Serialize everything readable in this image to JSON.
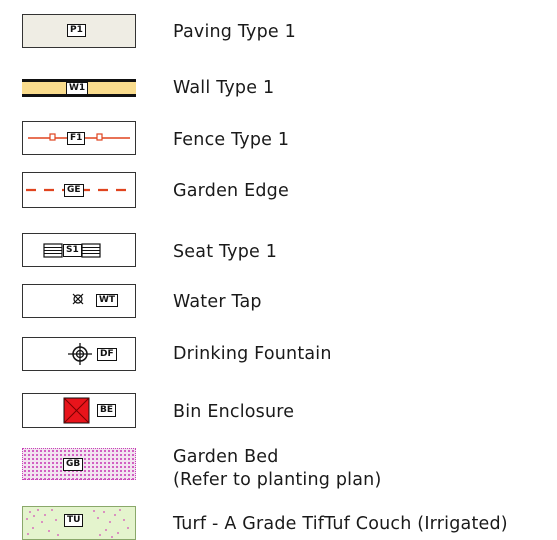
{
  "legend": [
    {
      "code": "P1",
      "label": "Paving Type 1"
    },
    {
      "code": "W1",
      "label": "Wall Type 1"
    },
    {
      "code": "F1",
      "label": "Fence Type 1"
    },
    {
      "code": "GE",
      "label": "Garden Edge"
    },
    {
      "code": "S1",
      "label": "Seat Type 1"
    },
    {
      "code": "WT",
      "label": "Water Tap"
    },
    {
      "code": "DF",
      "label": "Drinking Fountain"
    },
    {
      "code": "BE",
      "label": "Bin Enclosure"
    },
    {
      "code": "GB",
      "label": "Garden Bed",
      "label_line2": "(Refer to planting plan)"
    },
    {
      "code": "TU",
      "label": "Turf - A Grade TifTuf Couch (Irrigated)"
    }
  ],
  "colors": {
    "paving_fill": "#efede4",
    "wall_fill": "#f9dc8d",
    "fence_red": "#e0441f",
    "garden_edge_red": "#e0441f",
    "bin_red": "#e8141b",
    "garden_bed_fill": "#f2e4f0",
    "garden_bed_dots": "#c93fb7",
    "turf_fill": "#e4f4cd",
    "turf_dots": "#d24bb8"
  }
}
